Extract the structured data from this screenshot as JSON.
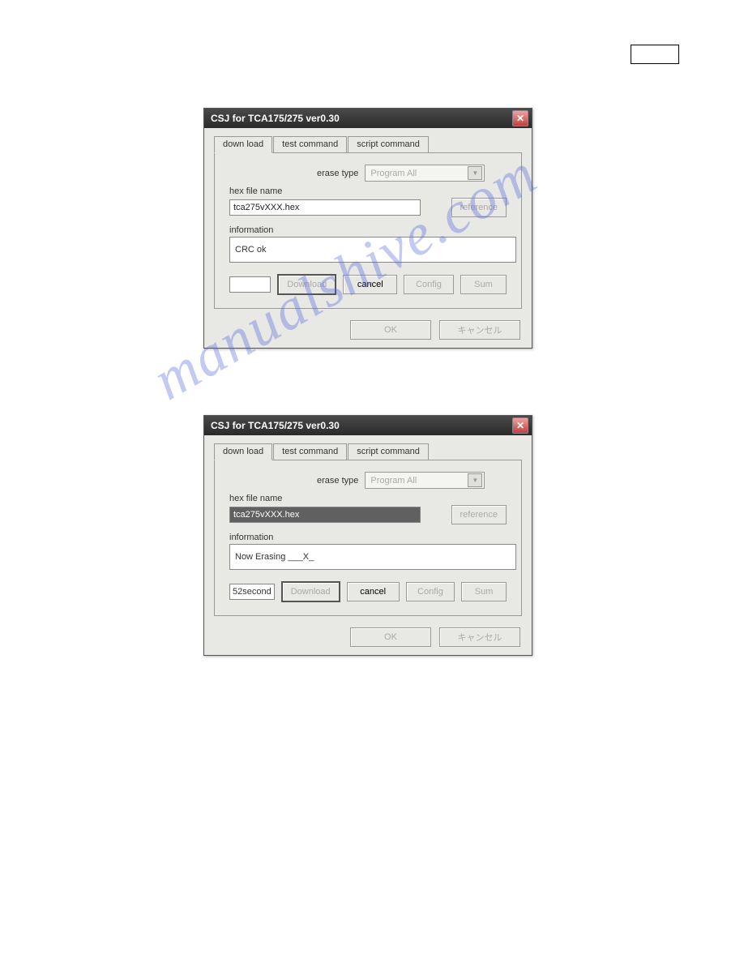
{
  "watermark": "manualshive.com",
  "dialog1": {
    "title": "CSJ for TCA175/275 ver0.30",
    "tabs": [
      "down load",
      "test command",
      "script command"
    ],
    "erase_label": "erase type",
    "erase_value": "Program All",
    "hex_label": "hex file name",
    "hex_value": "tca275vXXX.hex",
    "ref_btn": "reference",
    "info_label": "information",
    "info_value": "CRC ok",
    "time_value": "",
    "download_btn": "Download",
    "cancel_btn": "cancel",
    "config_btn": "Config",
    "sum_btn": "Sum",
    "ok_btn": "OK",
    "cancel2_btn": "キャンセル"
  },
  "dialog2": {
    "title": "CSJ for TCA175/275 ver0.30",
    "tabs": [
      "down load",
      "test command",
      "script command"
    ],
    "erase_label": "erase type",
    "erase_value": "Program All",
    "hex_label": "hex file name",
    "hex_value": "tca275vXXX.hex",
    "ref_btn": "reference",
    "info_label": "information",
    "info_value": "Now Erasing ___X_",
    "time_value": "52second",
    "download_btn": "Download",
    "cancel_btn": "cancel",
    "config_btn": "Config",
    "sum_btn": "Sum",
    "ok_btn": "OK",
    "cancel2_btn": "キャンセル"
  }
}
